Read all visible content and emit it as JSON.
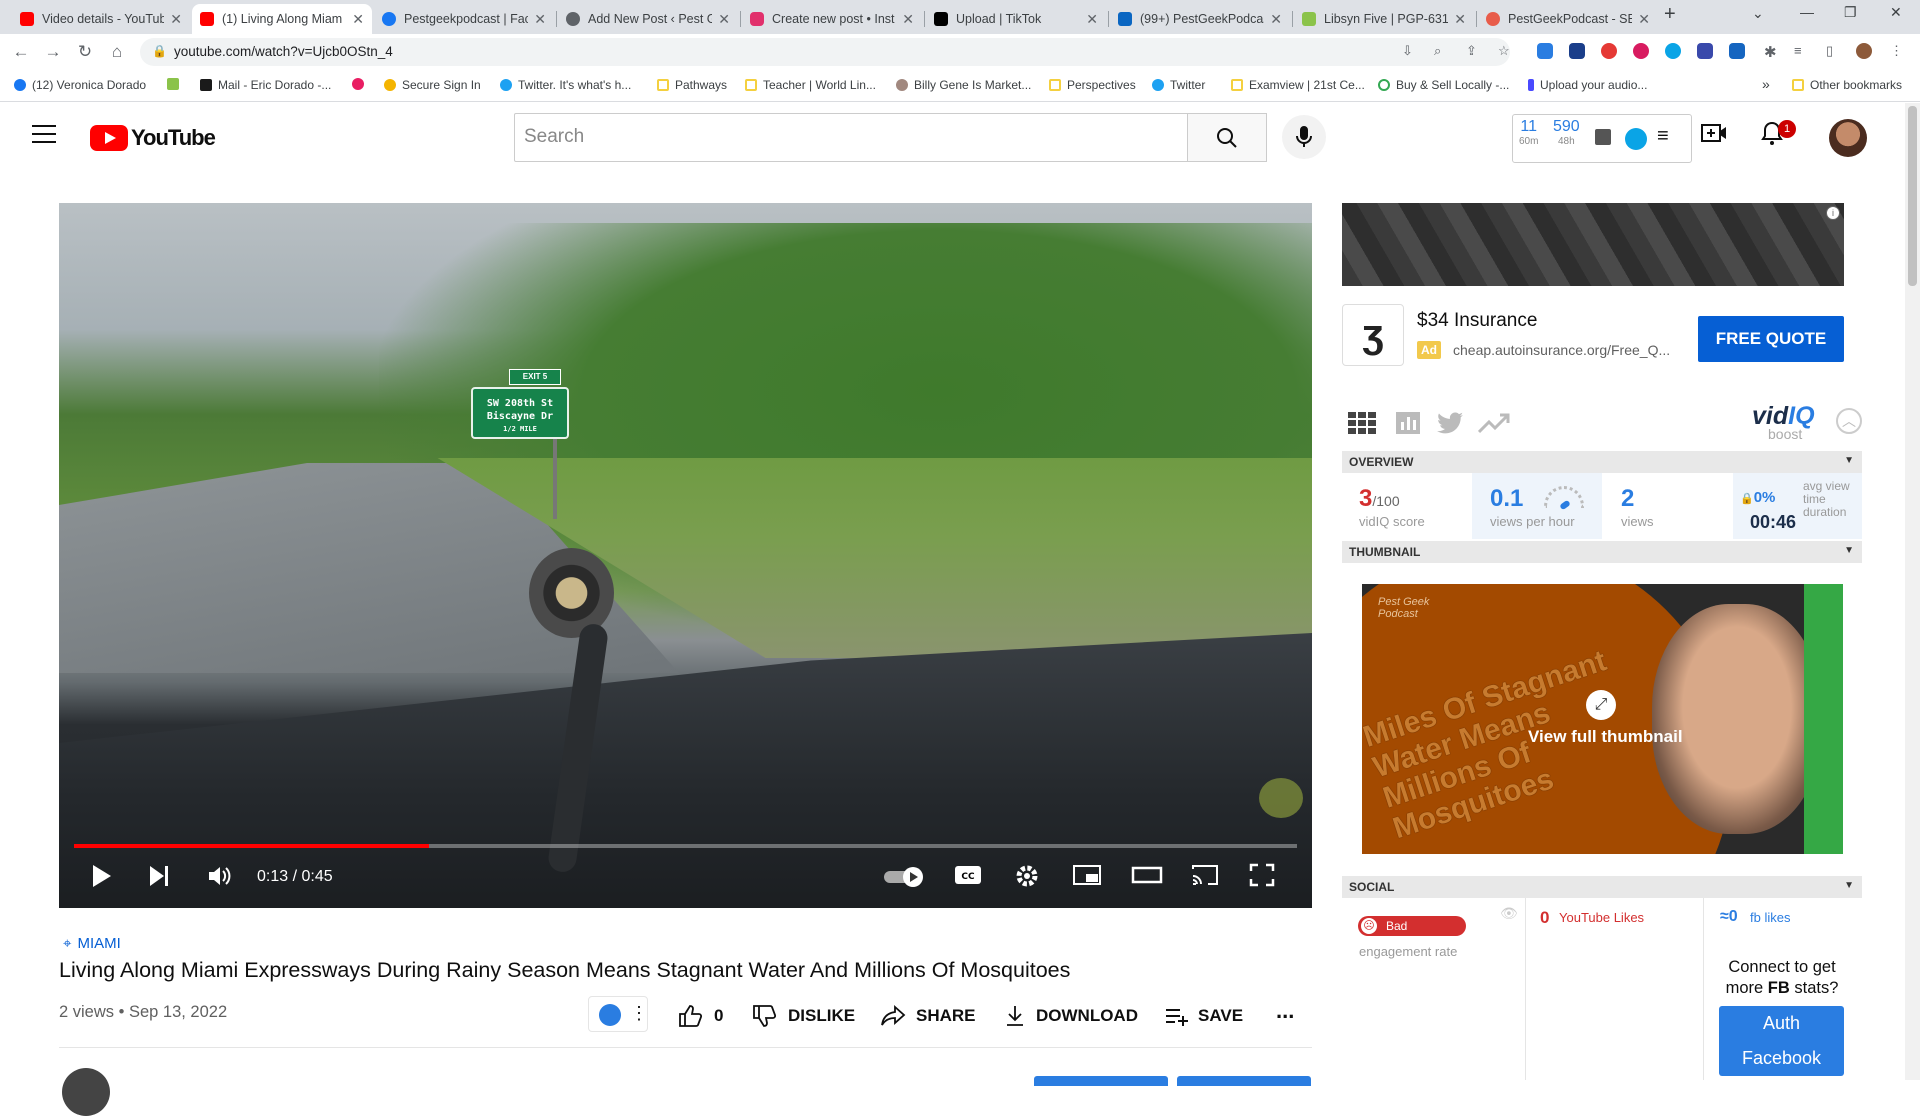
{
  "browser": {
    "tabs": [
      {
        "title": "Video details - YouTub",
        "color": "#ff0000"
      },
      {
        "title": "(1) Living Along Miam",
        "color": "#ff0000"
      },
      {
        "title": "Pestgeekpodcast | Fac",
        "color": "#1877f2"
      },
      {
        "title": "Add New Post ‹ Pest G",
        "color": "#5f6368"
      },
      {
        "title": "Create new post • Inst",
        "color": "#e1306c"
      },
      {
        "title": "Upload | TikTok",
        "color": "#000000"
      },
      {
        "title": "(99+) PestGeekPodcas",
        "color": "#0a66c2"
      },
      {
        "title": "Libsyn Five | PGP-631",
        "color": "#8bc34a"
      },
      {
        "title": "PestGeekPodcast - SE",
        "color": "#e85c4a"
      }
    ],
    "new_tab": "+",
    "url": "youtube.com/watch?v=Ujcb0OStn_4",
    "bookmarks": [
      {
        "label": "(12) Veronica Dorado",
        "color": "#1877f2"
      },
      {
        "label": "",
        "color": "#8bc34a"
      },
      {
        "label": "Mail - Eric Dorado -...",
        "color": "#1a1a1a"
      },
      {
        "label": "",
        "color": "#e91e63"
      },
      {
        "label": "Secure Sign In",
        "color": "#f4b400"
      },
      {
        "label": "Twitter. It's what's h...",
        "color": "#1da1f2"
      },
      {
        "label": "Pathways",
        "color": "#f4d03f"
      },
      {
        "label": "Teacher | World Lin...",
        "color": "#f4d03f"
      },
      {
        "label": "Billy Gene Is Market...",
        "color": "#a1887f"
      },
      {
        "label": "Perspectives",
        "color": "#f4d03f"
      },
      {
        "label": "Twitter",
        "color": "#1da1f2"
      },
      {
        "label": "Examview | 21st Ce...",
        "color": "#f4d03f"
      },
      {
        "label": "Buy & Sell Locally -...",
        "color": "#34a853"
      },
      {
        "label": "Upload your audio...",
        "color": "#4a4aff"
      }
    ],
    "more_bookmarks": "»",
    "other_bookmarks": "Other bookmarks"
  },
  "youtube": {
    "logo_text": "YouTube",
    "search_placeholder": "Search",
    "vidiq_header": {
      "views_60m": "11",
      "label_60m": "60m",
      "views_48h": "590",
      "label_48h": "48h"
    },
    "notification_count": "1"
  },
  "player": {
    "time": "0:13 / 0:45",
    "progress_fraction": 0.29,
    "sign_line1": "EXIT 5",
    "sign_line2": "SW 208th St",
    "sign_line3": "Biscayne Dr",
    "sign_line4": "1/2 MILE"
  },
  "video": {
    "location": "MIAMI",
    "title": "Living Along Miami Expressways During Rainy Season Means Stagnant Water And Millions Of Mosquitoes",
    "meta": "2 views • Sep 13, 2022",
    "likes": "0",
    "dislike_label": "DISLIKE",
    "share_label": "SHARE",
    "download_label": "DOWNLOAD",
    "save_label": "SAVE",
    "more": "..."
  },
  "ad": {
    "title": "$34 Insurance",
    "tag": "Ad",
    "url": "cheap.autoinsurance.org/Free_Q...",
    "cta": "FREE QUOTE",
    "info": "i"
  },
  "vidiq": {
    "logo_a": "vid",
    "logo_b": "IQ",
    "boost": "boost",
    "overview": {
      "header": "OVERVIEW",
      "score": "3",
      "score_max": "/100",
      "score_label": "vidIQ score",
      "vph": "0.1",
      "vph_label": "views per hour",
      "views": "2",
      "views_label": "views",
      "avd_pct": "0%",
      "avd_time": "00:46",
      "avd_label": "avg view time duration"
    },
    "thumbnail": {
      "header": "THUMBNAIL",
      "brand": "Pest Geek Podcast",
      "text": "Miles Of Stagnant Water Means Millions Of Mosquitoes",
      "view_full": "View full thumbnail"
    },
    "social": {
      "header": "SOCIAL",
      "engagement_badge": "Bad",
      "engagement_label": "engagement rate",
      "yt_likes_value": "0",
      "yt_likes_label": "YouTube Likes",
      "fb_likes_value": "≈0",
      "fb_likes_label": "fb likes",
      "connect_text_1": "Connect to get",
      "connect_text_2a": "more ",
      "connect_text_2b": "FB",
      "connect_text_2c": " stats?",
      "auth_line1": "Auth",
      "auth_line2": "Facebook"
    }
  }
}
